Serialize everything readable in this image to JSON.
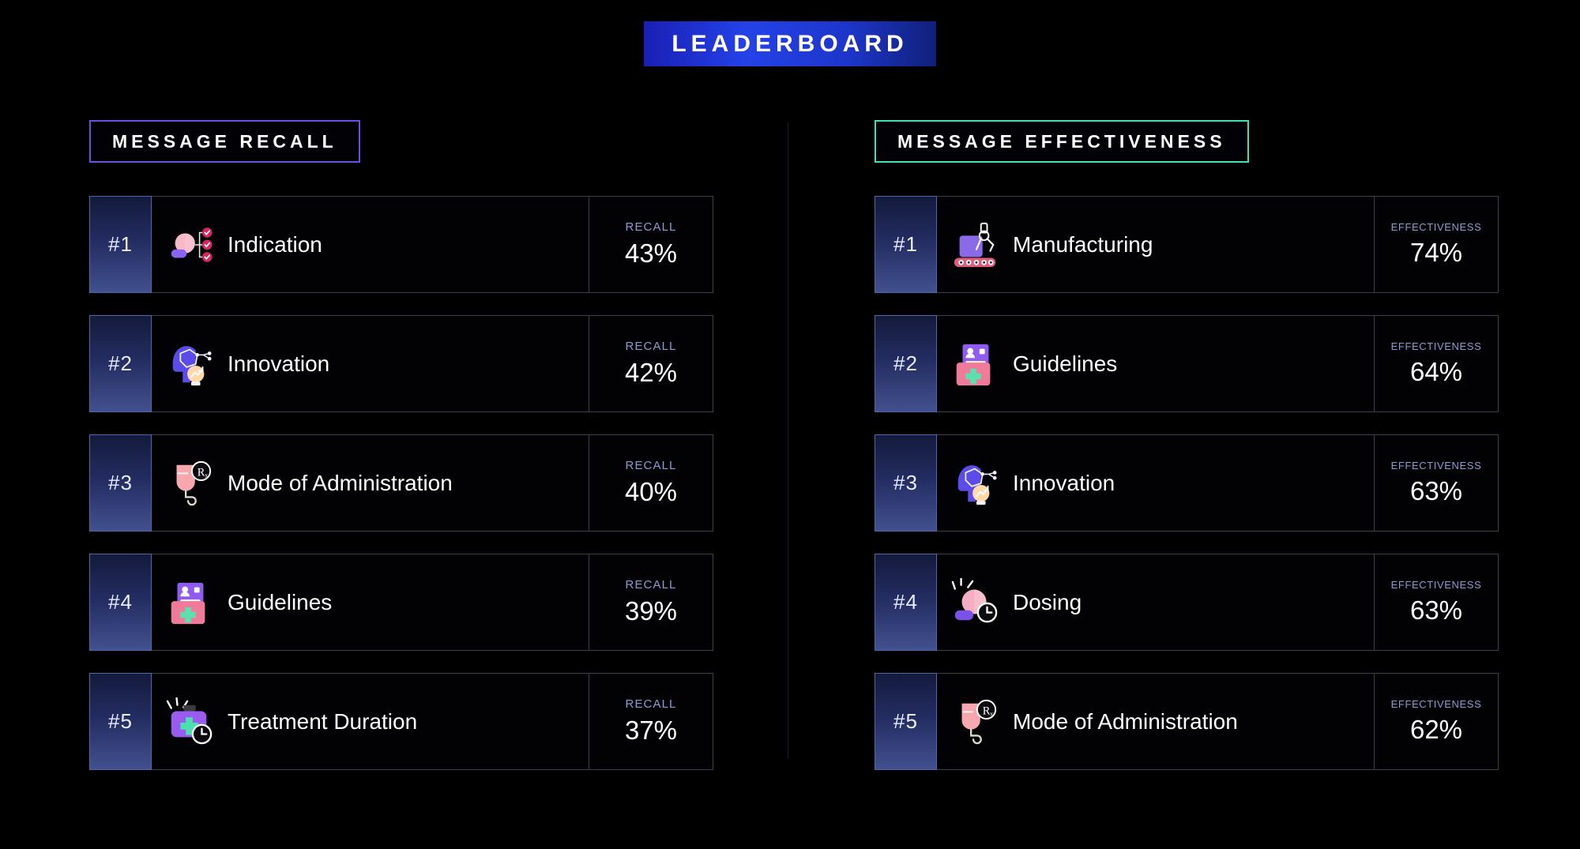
{
  "header": {
    "title": "LEADERBOARD",
    "accent_color": "#2442e8"
  },
  "divider": {
    "color": "#1d1d33"
  },
  "columns": [
    {
      "id": "message-recall",
      "heading": "MESSAGE RECALL",
      "accent_color": "#6b4fe0",
      "metric_label": "RECALL",
      "rows": [
        {
          "rank": "#1",
          "label": "Indication",
          "icon": "indication-icon",
          "metric_label": "RECALL",
          "value": "43%"
        },
        {
          "rank": "#2",
          "label": "Innovation",
          "icon": "innovation-icon",
          "metric_label": "RECALL",
          "value": "42%"
        },
        {
          "rank": "#3",
          "label": "Mode of Administration",
          "icon": "mode-of-administration-icon",
          "metric_label": "RECALL",
          "value": "40%"
        },
        {
          "rank": "#4",
          "label": "Guidelines",
          "icon": "guidelines-icon",
          "metric_label": "RECALL",
          "value": "39%"
        },
        {
          "rank": "#5",
          "label": "Treatment Duration",
          "icon": "treatment-duration-icon",
          "metric_label": "RECALL",
          "value": "37%"
        }
      ]
    },
    {
      "id": "message-effectiveness",
      "heading": "MESSAGE EFFECTIVENESS",
      "accent_color": "#3fe0b8",
      "metric_label": "EFFECTIVENESS",
      "rows": [
        {
          "rank": "#1",
          "label": "Manufacturing",
          "icon": "manufacturing-icon",
          "metric_label": "EFFECTIVENESS",
          "value": "74%"
        },
        {
          "rank": "#2",
          "label": "Guidelines",
          "icon": "guidelines-icon",
          "metric_label": "EFFECTIVENESS",
          "value": "64%"
        },
        {
          "rank": "#3",
          "label": "Innovation",
          "icon": "innovation-icon",
          "metric_label": "EFFECTIVENESS",
          "value": "63%"
        },
        {
          "rank": "#4",
          "label": "Dosing",
          "icon": "dosing-icon",
          "metric_label": "EFFECTIVENESS",
          "value": "63%"
        },
        {
          "rank": "#5",
          "label": "Mode of Administration",
          "icon": "mode-of-administration-icon",
          "metric_label": "EFFECTIVENESS",
          "value": "62%"
        }
      ]
    }
  ]
}
